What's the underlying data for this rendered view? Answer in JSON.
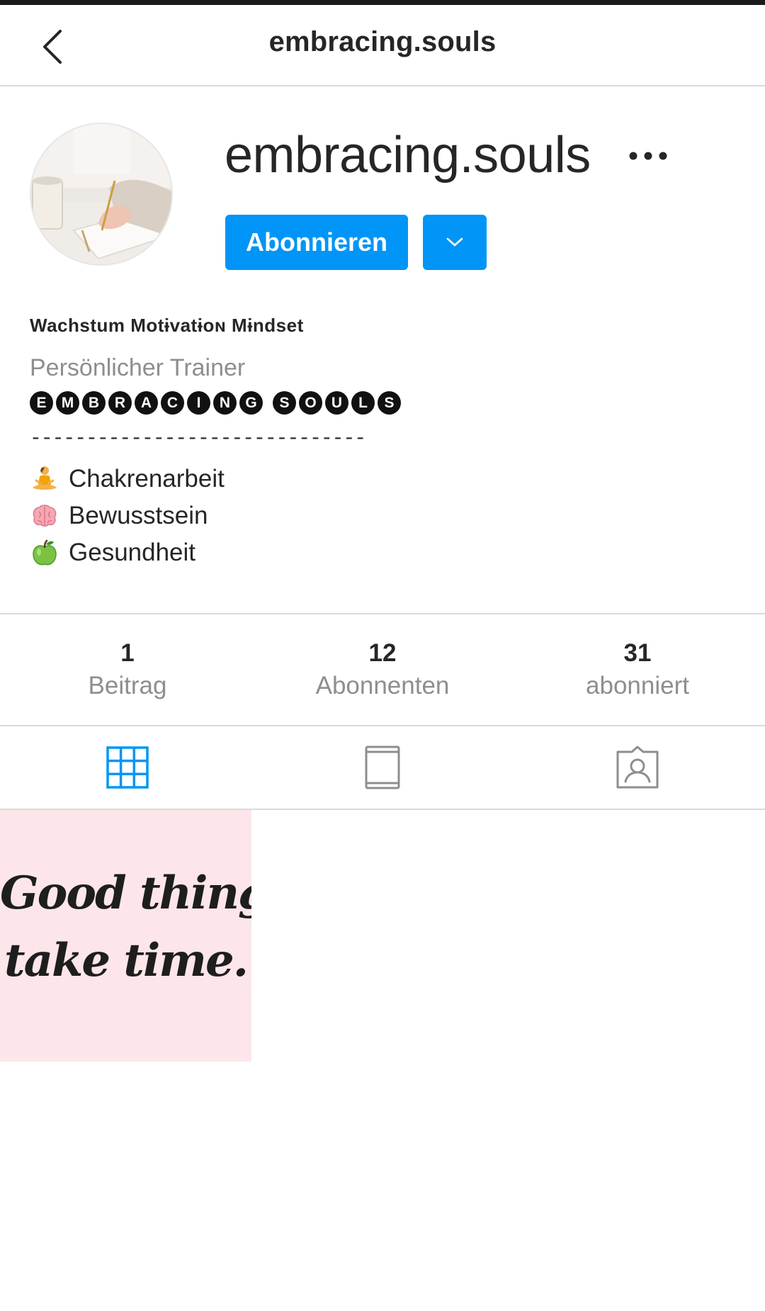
{
  "header": {
    "title": "embracing.souls",
    "back_icon": "chevron-left-icon"
  },
  "profile": {
    "username": "embracing.souls",
    "more_icon": "more-horizontal-icon",
    "follow_label": "Abonnieren",
    "dropdown_icon": "chevron-down-icon"
  },
  "bio": {
    "name": "Wachstum Motɨvatɨoɴ Mɨndset",
    "category": "Persönlicher Trainer",
    "brand_words": [
      [
        "E",
        "M",
        "B",
        "R",
        "A",
        "C",
        "I",
        "N",
        "G"
      ],
      [
        "S",
        "O",
        "U",
        "L",
        "S"
      ]
    ],
    "brand_text": "🅔🅜🅑🅡🅐🅒🅘🅝🅖 🅢🅞🅤🅛🅢",
    "divider": "------------------------------",
    "lines": [
      {
        "emoji": "🧘",
        "text": "Chakrenarbeit"
      },
      {
        "emoji": "🧠",
        "text": "Bewusstsein"
      },
      {
        "emoji": "🍏",
        "text": "Gesundheit"
      }
    ]
  },
  "stats": [
    {
      "value": "1",
      "label": "Beitrag"
    },
    {
      "value": "12",
      "label": "Abonnenten"
    },
    {
      "value": "31",
      "label": "abonniert"
    }
  ],
  "tabs": [
    {
      "icon": "grid-icon",
      "active": true
    },
    {
      "icon": "igtv-icon",
      "active": false
    },
    {
      "icon": "tagged-icon",
      "active": false
    }
  ],
  "posts": [
    {
      "line1": "Good things",
      "line2": "take time."
    }
  ],
  "colors": {
    "accent": "#0095f6",
    "text": "#262626",
    "muted": "#8e8e8e",
    "divider": "#dbdbdb",
    "post_background": "#fde6ea"
  }
}
